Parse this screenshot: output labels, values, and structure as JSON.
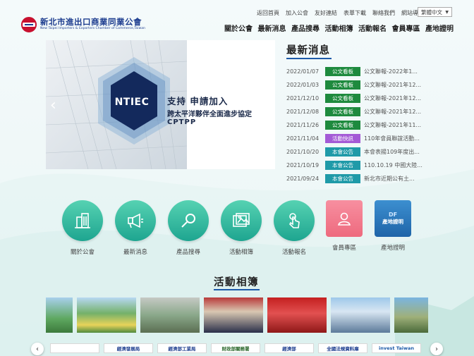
{
  "logo": {
    "zh": "新北市進出口商業同業公會",
    "en": "New Taipei Importers & Exporters Chamber of Commerce,Taiwan"
  },
  "top_links": [
    "返回首頁",
    "加入公會",
    "友好連結",
    "表單下載",
    "聯絡我們",
    "網站導覽"
  ],
  "language": {
    "selected": "繁體中文"
  },
  "main_nav": [
    "關於公會",
    "最新消息",
    "產品搜尋",
    "活動相簿",
    "活動報名",
    "會員專區",
    "產地證明"
  ],
  "banner": {
    "hex_label": "NTIEC",
    "title": "支持 申請加入",
    "subtitle": "跨太平洋夥伴全面進步協定",
    "subtitle2": "CPTPP"
  },
  "news": {
    "title": "最新消息",
    "items": [
      {
        "date": "2022/01/07",
        "tag": "公文看板",
        "tag_color": "#1e8a3e",
        "text": "公文聯報-2022年1..."
      },
      {
        "date": "2022/01/03",
        "tag": "公文看板",
        "tag_color": "#1e8a3e",
        "text": "公文聯報-2021年12..."
      },
      {
        "date": "2021/12/10",
        "tag": "公文看板",
        "tag_color": "#1e8a3e",
        "text": "公文聯報-2021年12..."
      },
      {
        "date": "2021/12/08",
        "tag": "公文看板",
        "tag_color": "#1e8a3e",
        "text": "公文聯報-2021年12..."
      },
      {
        "date": "2021/11/26",
        "tag": "公文看板",
        "tag_color": "#1e8a3e",
        "text": "公文聯報-2021年11..."
      },
      {
        "date": "2021/11/04",
        "tag": "活動快訊",
        "tag_color": "#a45ad6",
        "text": "110年會員聯誼活動..."
      },
      {
        "date": "2021/10/20",
        "tag": "本會公告",
        "tag_color": "#1f9aa8",
        "text": "本會表揚109年度出..."
      },
      {
        "date": "2021/10/19",
        "tag": "本會公告",
        "tag_color": "#1f9aa8",
        "text": "110.10.19 中國大陸..."
      },
      {
        "date": "2021/09/24",
        "tag": "本會公告",
        "tag_color": "#1f9aa8",
        "text": "新北市近期公有土..."
      }
    ]
  },
  "quick_links": [
    {
      "label": "關於公會",
      "icon": "building-icon"
    },
    {
      "label": "最新消息",
      "icon": "megaphone-icon"
    },
    {
      "label": "產品搜尋",
      "icon": "magnifier-icon"
    },
    {
      "label": "活動相簿",
      "icon": "photo-album-icon"
    },
    {
      "label": "活動報名",
      "icon": "tap-hand-icon"
    },
    {
      "label": "會員專區",
      "icon": "member-icon"
    },
    {
      "label": "產地證明",
      "icon": "certificate-icon",
      "badge_top": "DF",
      "badge_text": "產地證明"
    }
  ],
  "album": {
    "title": "活動相簿"
  },
  "partners": [
    {
      "text": ""
    },
    {
      "text": "經濟發展局"
    },
    {
      "text": "經濟部工業局"
    },
    {
      "text": "財政部關務署"
    },
    {
      "text": "經濟部"
    },
    {
      "text": "全國法規資料庫"
    },
    {
      "text": "invest Taiwan"
    }
  ],
  "colors": {
    "accent_blue": "#1c5aa8",
    "quick_green": "#2bb59a",
    "member_pink": "#f27a8c",
    "cert_blue": "#2f7fc1"
  }
}
